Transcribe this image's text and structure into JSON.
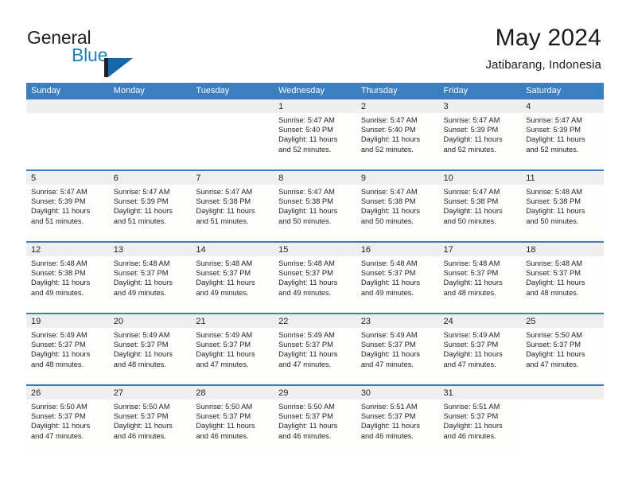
{
  "brand": {
    "word_one": "General",
    "word_two": "Blue",
    "mark_icon": "triangle-logo-icon",
    "primary_color": "#1668ad",
    "dark_color": "#231f20"
  },
  "header": {
    "title": "May 2024",
    "subtitle": "Jatibarang, Indonesia"
  },
  "theme": {
    "header_bar_color": "#3b7fc0",
    "daynum_band_color": "#efefef",
    "row_divider_color": "#3b7fc0",
    "text_color": "#231f20"
  },
  "calendar": {
    "weekdays": [
      "Sunday",
      "Monday",
      "Tuesday",
      "Wednesday",
      "Thursday",
      "Friday",
      "Saturday"
    ],
    "weeks": [
      [
        {
          "day": "",
          "sunrise": "",
          "sunset": "",
          "daylight_line1": "",
          "daylight_line2": ""
        },
        {
          "day": "",
          "sunrise": "",
          "sunset": "",
          "daylight_line1": "",
          "daylight_line2": ""
        },
        {
          "day": "",
          "sunrise": "",
          "sunset": "",
          "daylight_line1": "",
          "daylight_line2": ""
        },
        {
          "day": "1",
          "sunrise": "Sunrise: 5:47 AM",
          "sunset": "Sunset: 5:40 PM",
          "daylight_line1": "Daylight: 11 hours",
          "daylight_line2": "and 52 minutes."
        },
        {
          "day": "2",
          "sunrise": "Sunrise: 5:47 AM",
          "sunset": "Sunset: 5:40 PM",
          "daylight_line1": "Daylight: 11 hours",
          "daylight_line2": "and 52 minutes."
        },
        {
          "day": "3",
          "sunrise": "Sunrise: 5:47 AM",
          "sunset": "Sunset: 5:39 PM",
          "daylight_line1": "Daylight: 11 hours",
          "daylight_line2": "and 52 minutes."
        },
        {
          "day": "4",
          "sunrise": "Sunrise: 5:47 AM",
          "sunset": "Sunset: 5:39 PM",
          "daylight_line1": "Daylight: 11 hours",
          "daylight_line2": "and 52 minutes."
        }
      ],
      [
        {
          "day": "5",
          "sunrise": "Sunrise: 5:47 AM",
          "sunset": "Sunset: 5:39 PM",
          "daylight_line1": "Daylight: 11 hours",
          "daylight_line2": "and 51 minutes."
        },
        {
          "day": "6",
          "sunrise": "Sunrise: 5:47 AM",
          "sunset": "Sunset: 5:39 PM",
          "daylight_line1": "Daylight: 11 hours",
          "daylight_line2": "and 51 minutes."
        },
        {
          "day": "7",
          "sunrise": "Sunrise: 5:47 AM",
          "sunset": "Sunset: 5:38 PM",
          "daylight_line1": "Daylight: 11 hours",
          "daylight_line2": "and 51 minutes."
        },
        {
          "day": "8",
          "sunrise": "Sunrise: 5:47 AM",
          "sunset": "Sunset: 5:38 PM",
          "daylight_line1": "Daylight: 11 hours",
          "daylight_line2": "and 50 minutes."
        },
        {
          "day": "9",
          "sunrise": "Sunrise: 5:47 AM",
          "sunset": "Sunset: 5:38 PM",
          "daylight_line1": "Daylight: 11 hours",
          "daylight_line2": "and 50 minutes."
        },
        {
          "day": "10",
          "sunrise": "Sunrise: 5:47 AM",
          "sunset": "Sunset: 5:38 PM",
          "daylight_line1": "Daylight: 11 hours",
          "daylight_line2": "and 50 minutes."
        },
        {
          "day": "11",
          "sunrise": "Sunrise: 5:48 AM",
          "sunset": "Sunset: 5:38 PM",
          "daylight_line1": "Daylight: 11 hours",
          "daylight_line2": "and 50 minutes."
        }
      ],
      [
        {
          "day": "12",
          "sunrise": "Sunrise: 5:48 AM",
          "sunset": "Sunset: 5:38 PM",
          "daylight_line1": "Daylight: 11 hours",
          "daylight_line2": "and 49 minutes."
        },
        {
          "day": "13",
          "sunrise": "Sunrise: 5:48 AM",
          "sunset": "Sunset: 5:37 PM",
          "daylight_line1": "Daylight: 11 hours",
          "daylight_line2": "and 49 minutes."
        },
        {
          "day": "14",
          "sunrise": "Sunrise: 5:48 AM",
          "sunset": "Sunset: 5:37 PM",
          "daylight_line1": "Daylight: 11 hours",
          "daylight_line2": "and 49 minutes."
        },
        {
          "day": "15",
          "sunrise": "Sunrise: 5:48 AM",
          "sunset": "Sunset: 5:37 PM",
          "daylight_line1": "Daylight: 11 hours",
          "daylight_line2": "and 49 minutes."
        },
        {
          "day": "16",
          "sunrise": "Sunrise: 5:48 AM",
          "sunset": "Sunset: 5:37 PM",
          "daylight_line1": "Daylight: 11 hours",
          "daylight_line2": "and 49 minutes."
        },
        {
          "day": "17",
          "sunrise": "Sunrise: 5:48 AM",
          "sunset": "Sunset: 5:37 PM",
          "daylight_line1": "Daylight: 11 hours",
          "daylight_line2": "and 48 minutes."
        },
        {
          "day": "18",
          "sunrise": "Sunrise: 5:48 AM",
          "sunset": "Sunset: 5:37 PM",
          "daylight_line1": "Daylight: 11 hours",
          "daylight_line2": "and 48 minutes."
        }
      ],
      [
        {
          "day": "19",
          "sunrise": "Sunrise: 5:49 AM",
          "sunset": "Sunset: 5:37 PM",
          "daylight_line1": "Daylight: 11 hours",
          "daylight_line2": "and 48 minutes."
        },
        {
          "day": "20",
          "sunrise": "Sunrise: 5:49 AM",
          "sunset": "Sunset: 5:37 PM",
          "daylight_line1": "Daylight: 11 hours",
          "daylight_line2": "and 48 minutes."
        },
        {
          "day": "21",
          "sunrise": "Sunrise: 5:49 AM",
          "sunset": "Sunset: 5:37 PM",
          "daylight_line1": "Daylight: 11 hours",
          "daylight_line2": "and 47 minutes."
        },
        {
          "day": "22",
          "sunrise": "Sunrise: 5:49 AM",
          "sunset": "Sunset: 5:37 PM",
          "daylight_line1": "Daylight: 11 hours",
          "daylight_line2": "and 47 minutes."
        },
        {
          "day": "23",
          "sunrise": "Sunrise: 5:49 AM",
          "sunset": "Sunset: 5:37 PM",
          "daylight_line1": "Daylight: 11 hours",
          "daylight_line2": "and 47 minutes."
        },
        {
          "day": "24",
          "sunrise": "Sunrise: 5:49 AM",
          "sunset": "Sunset: 5:37 PM",
          "daylight_line1": "Daylight: 11 hours",
          "daylight_line2": "and 47 minutes."
        },
        {
          "day": "25",
          "sunrise": "Sunrise: 5:50 AM",
          "sunset": "Sunset: 5:37 PM",
          "daylight_line1": "Daylight: 11 hours",
          "daylight_line2": "and 47 minutes."
        }
      ],
      [
        {
          "day": "26",
          "sunrise": "Sunrise: 5:50 AM",
          "sunset": "Sunset: 5:37 PM",
          "daylight_line1": "Daylight: 11 hours",
          "daylight_line2": "and 47 minutes."
        },
        {
          "day": "27",
          "sunrise": "Sunrise: 5:50 AM",
          "sunset": "Sunset: 5:37 PM",
          "daylight_line1": "Daylight: 11 hours",
          "daylight_line2": "and 46 minutes."
        },
        {
          "day": "28",
          "sunrise": "Sunrise: 5:50 AM",
          "sunset": "Sunset: 5:37 PM",
          "daylight_line1": "Daylight: 11 hours",
          "daylight_line2": "and 46 minutes."
        },
        {
          "day": "29",
          "sunrise": "Sunrise: 5:50 AM",
          "sunset": "Sunset: 5:37 PM",
          "daylight_line1": "Daylight: 11 hours",
          "daylight_line2": "and 46 minutes."
        },
        {
          "day": "30",
          "sunrise": "Sunrise: 5:51 AM",
          "sunset": "Sunset: 5:37 PM",
          "daylight_line1": "Daylight: 11 hours",
          "daylight_line2": "and 46 minutes."
        },
        {
          "day": "31",
          "sunrise": "Sunrise: 5:51 AM",
          "sunset": "Sunset: 5:37 PM",
          "daylight_line1": "Daylight: 11 hours",
          "daylight_line2": "and 46 minutes."
        },
        {
          "day": "",
          "sunrise": "",
          "sunset": "",
          "daylight_line1": "",
          "daylight_line2": ""
        }
      ]
    ]
  }
}
